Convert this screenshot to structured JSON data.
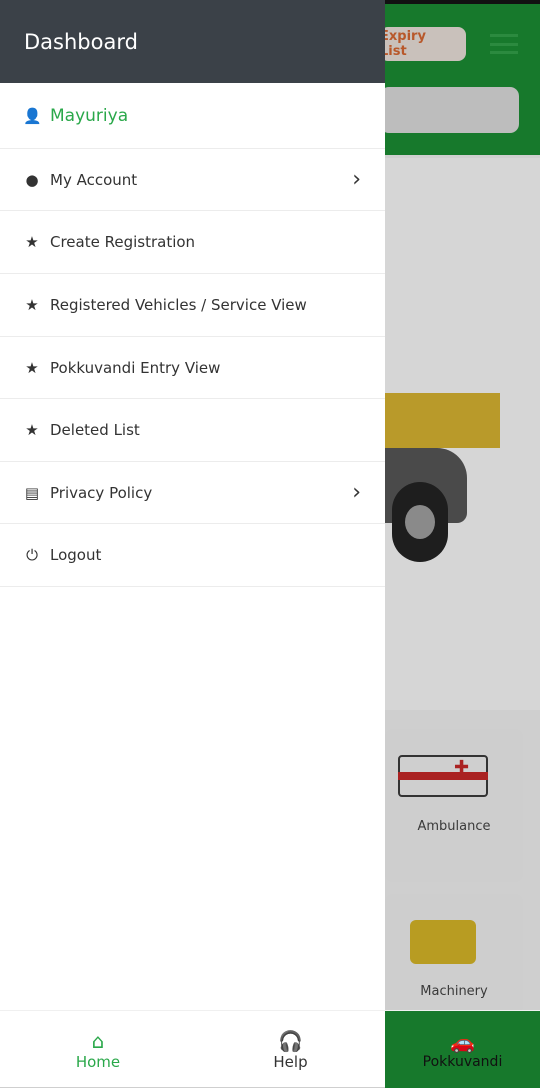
{
  "background": {
    "expiry_label": "Expiry List",
    "cards": [
      {
        "label": "Ambulance"
      },
      {
        "label": "Machinery"
      }
    ]
  },
  "drawer": {
    "title": "Dashboard",
    "user": {
      "name": "Mayuriya",
      "icon": "user-tie-icon"
    },
    "items": [
      {
        "label": "My Account",
        "icon": "user-icon",
        "has_chevron": true
      },
      {
        "label": "Create Registration",
        "icon": "star-icon"
      },
      {
        "label": "Registered Vehicles / Service View",
        "icon": "star-icon"
      },
      {
        "label": "Pokkuvandi Entry View",
        "icon": "star-icon"
      },
      {
        "label": "Deleted List",
        "icon": "star-icon"
      },
      {
        "label": "Privacy Policy",
        "icon": "document-icon",
        "has_chevron": true
      },
      {
        "label": "Logout",
        "icon": "power-icon"
      }
    ]
  },
  "bottom_nav": {
    "home": "Home",
    "help": "Help",
    "pokkuvandi": "Pokkuvandi",
    "active": "Home"
  },
  "colors": {
    "accent": "#2aa84a",
    "drawer_header": "#3b4148",
    "app_green": "#17792c"
  }
}
